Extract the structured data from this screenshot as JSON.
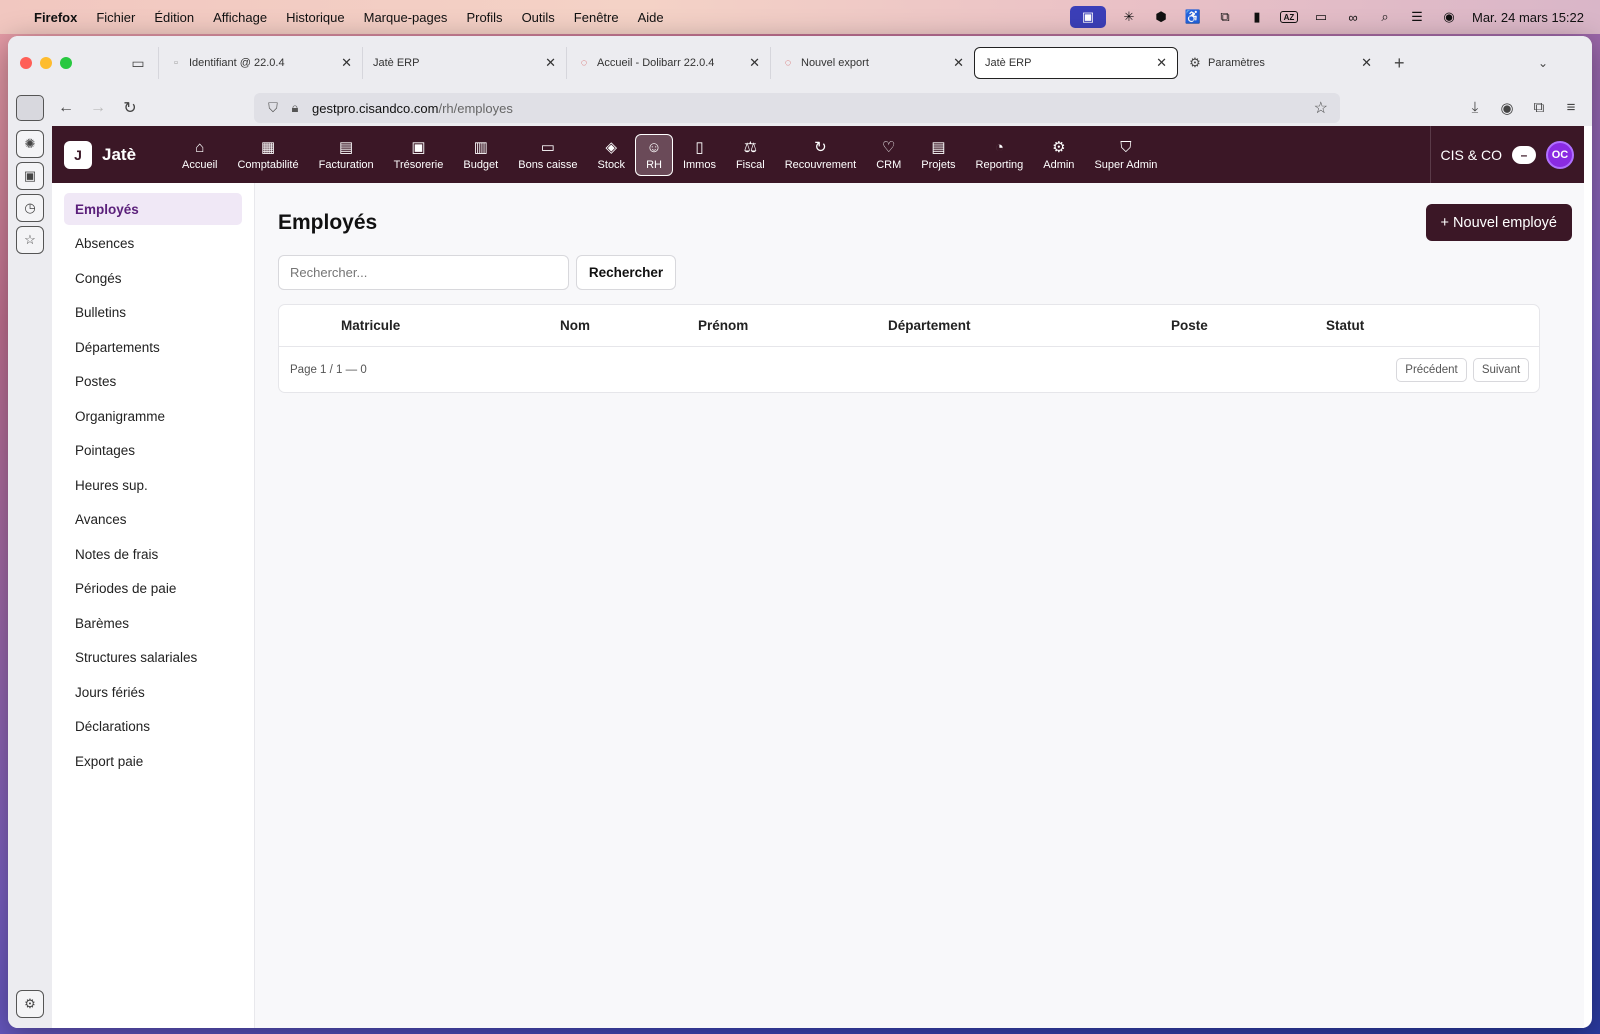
{
  "menubar": {
    "app": "Firefox",
    "items": [
      "Fichier",
      "Édition",
      "Affichage",
      "Historique",
      "Marque-pages",
      "Profils",
      "Outils",
      "Fenêtre",
      "Aide"
    ],
    "clock": "Mar. 24 mars  15:22"
  },
  "browser": {
    "tabs": [
      {
        "label": "Identifiant @ 22.0.4",
        "active": false
      },
      {
        "label": "Jatè ERP",
        "active": false
      },
      {
        "label": "Accueil - Dolibarr 22.0.4",
        "active": false
      },
      {
        "label": "Nouvel export",
        "active": false
      },
      {
        "label": "Jatè ERP",
        "active": true
      },
      {
        "label": "Paramètres",
        "active": false
      }
    ],
    "url_host": "gestpro.cisandco.com",
    "url_path": "/rh/employes"
  },
  "app": {
    "logo_letter": "J",
    "name": "Jatè",
    "modules": [
      {
        "label": "Accueil",
        "icon": "home-icon",
        "glyph": "⌂"
      },
      {
        "label": "Comptabilité",
        "icon": "calculator-icon",
        "glyph": "▦"
      },
      {
        "label": "Facturation",
        "icon": "file-icon",
        "glyph": "▤"
      },
      {
        "label": "Trésorerie",
        "icon": "cash-icon",
        "glyph": "▣"
      },
      {
        "label": "Budget",
        "icon": "bar-chart-icon",
        "glyph": "▥"
      },
      {
        "label": "Bons caisse",
        "icon": "ticket-icon",
        "glyph": "▭"
      },
      {
        "label": "Stock",
        "icon": "box-icon",
        "glyph": "◈"
      },
      {
        "label": "RH",
        "icon": "users-icon",
        "glyph": "☺",
        "active": true
      },
      {
        "label": "Immos",
        "icon": "building-icon",
        "glyph": "▯"
      },
      {
        "label": "Fiscal",
        "icon": "scale-icon",
        "glyph": "⚖"
      },
      {
        "label": "Recouvrement",
        "icon": "refresh-icon",
        "glyph": "↻"
      },
      {
        "label": "CRM",
        "icon": "heart-icon",
        "glyph": "♡"
      },
      {
        "label": "Projets",
        "icon": "clipboard-icon",
        "glyph": "▤"
      },
      {
        "label": "Reporting",
        "icon": "pie-chart-icon",
        "glyph": "◔"
      },
      {
        "label": "Admin",
        "icon": "gear-icon",
        "glyph": "⚙"
      },
      {
        "label": "Super Admin",
        "icon": "shield-icon",
        "glyph": "⛉"
      }
    ],
    "company": "CIS & CO",
    "avatar": "OC",
    "toggle_glyph": "–"
  },
  "sidebar": {
    "items": [
      {
        "label": "Employés",
        "active": true
      },
      {
        "label": "Absences"
      },
      {
        "label": "Congés"
      },
      {
        "label": "Bulletins"
      },
      {
        "label": "Départements"
      },
      {
        "label": "Postes"
      },
      {
        "label": "Organigramme"
      },
      {
        "label": "Pointages"
      },
      {
        "label": "Heures sup."
      },
      {
        "label": "Avances"
      },
      {
        "label": "Notes de frais"
      },
      {
        "label": "Périodes de paie"
      },
      {
        "label": "Barèmes"
      },
      {
        "label": "Structures salariales"
      },
      {
        "label": "Jours fériés"
      },
      {
        "label": "Déclarations"
      },
      {
        "label": "Export paie"
      }
    ]
  },
  "main": {
    "title": "Employés",
    "new_button": "+ Nouvel employé",
    "search_placeholder": "Rechercher...",
    "search_button": "Rechercher",
    "columns": [
      "Matricule",
      "Nom",
      "Prénom",
      "Département",
      "Poste",
      "Statut"
    ],
    "page_info": "Page 1 / 1 — 0",
    "prev_button": "Précédent",
    "next_button": "Suivant"
  }
}
